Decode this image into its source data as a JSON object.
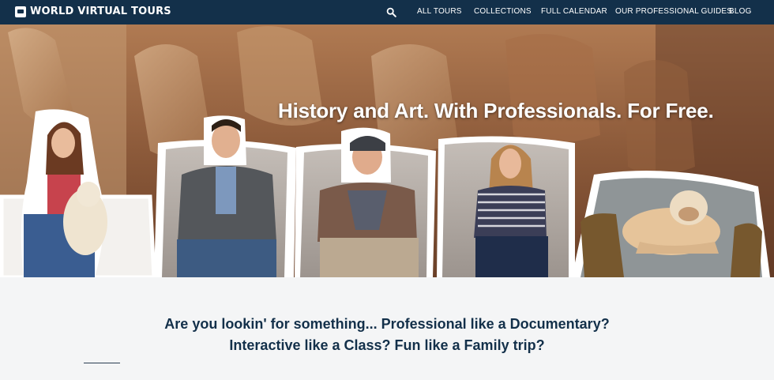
{
  "nav": {
    "logo_text": "WORLD VIRTUAL TOURS",
    "search_icon": "search-icon",
    "items": [
      {
        "label": "ALL TOURS"
      },
      {
        "label": "COLLECTIONS"
      },
      {
        "label": "FULL CALENDAR"
      },
      {
        "label": "OUR PROFESSIONAL GUIDES"
      },
      {
        "label": "BLOG"
      }
    ]
  },
  "hero": {
    "title": "History and Art. With Professionals. For Free."
  },
  "intro": {
    "line1": "Are you lookin' for something... Professional like a Documentary?",
    "line2": "Interactive like a Class? Fun like a Family trip?"
  },
  "colors": {
    "nav_bg": "#13304a",
    "heading_text": "#13304a",
    "intro_bg": "#f4f5f6"
  }
}
